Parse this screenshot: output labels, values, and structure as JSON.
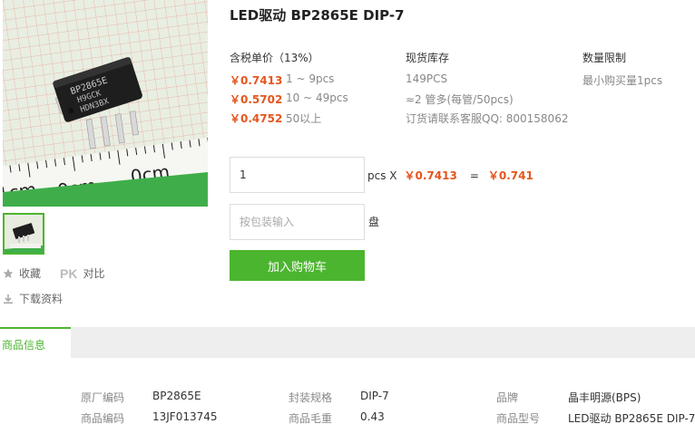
{
  "product": {
    "title": "LED驱动 BP2865E DIP-7"
  },
  "image": {
    "chip_text": [
      "BP2865E",
      "H9GCK",
      "HDN3BX"
    ],
    "ruler_text": [
      "1cm",
      "0cm",
      "0cm"
    ]
  },
  "sidebar": {
    "favorite_label": "收藏",
    "pk_mark": "PK",
    "compare_label": "对比",
    "download_label": "下载资料"
  },
  "pricing": {
    "header": "含税单价（13%）",
    "tiers": [
      {
        "price": "￥0.7413",
        "range": "1 ~ 9pcs"
      },
      {
        "price": "￥0.5702",
        "range": "10 ~ 49pcs"
      },
      {
        "price": "￥0.4752",
        "range": "50以上"
      }
    ]
  },
  "stock": {
    "header": "现货库存",
    "quantity": "149PCS",
    "packaging": "≈2 管多(每管/50pcs)",
    "contact": "订货请联系客服QQ: 800158062"
  },
  "limit": {
    "header": "数量限制",
    "min_purchase": "最小购买量1pcs"
  },
  "order": {
    "quantity_value": "1",
    "unit": "pcs X",
    "unit_price": "￥0.7413",
    "equals": "=",
    "total": "￥0.741",
    "pack_placeholder": "按包装输入",
    "pack_unit": "盘",
    "add_to_cart": "加入购物车"
  },
  "tabs": {
    "active": "商品信息"
  },
  "details": [
    {
      "label": "原厂编码",
      "value": "BP2865E"
    },
    {
      "label": "封装规格",
      "value": "DIP-7"
    },
    {
      "label": "品牌",
      "value": "晶丰明源(BPS)"
    },
    {
      "label": "商品编码",
      "value": "13JF013745"
    },
    {
      "label": "商品毛重",
      "value": "0.43"
    },
    {
      "label": "商品型号",
      "value": "LED驱动 BP2865E DIP-7"
    }
  ],
  "colors": {
    "accent_green": "#4cb52f",
    "price_orange": "#e4561e"
  }
}
